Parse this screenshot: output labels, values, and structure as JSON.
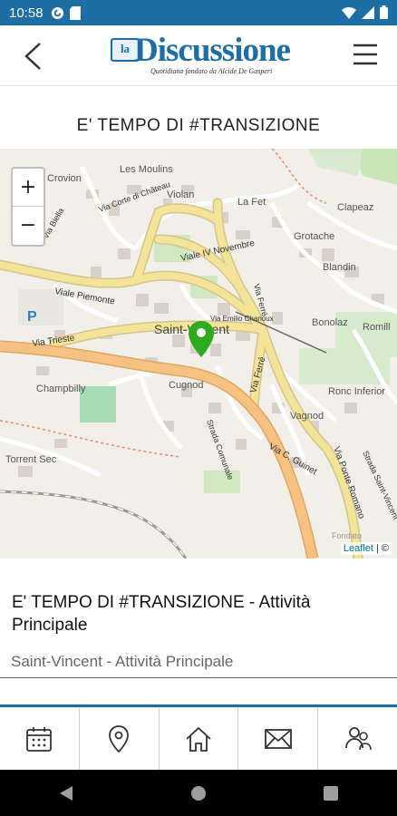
{
  "status_bar": {
    "time": "10:58",
    "left_icons": [
      "pocket-casts-icon",
      "sd-card-icon"
    ],
    "right_icons": [
      "wifi-icon",
      "signal-icon",
      "battery-icon"
    ]
  },
  "header": {
    "logo_prefix": "la",
    "logo_name": "Discussione",
    "logo_tagline": "Quotidiano fondato da Alcide De Gasperi",
    "back_icon": "chevron-left-icon",
    "menu_icon": "hamburger-menu-icon"
  },
  "page_title": "E' TEMPO DI #TRANSIZIONE",
  "map": {
    "zoom_in": "+",
    "zoom_out": "−",
    "attribution_link": "Leaflet",
    "attribution_rest": " | ©",
    "labels": {
      "crovion": "Crovion",
      "les_moulins": "Les Moulins",
      "violan": "Violan",
      "la_fet": "La Fet",
      "clapeaz": "Clapeaz",
      "grotache": "Grotache",
      "blandin": "Blandin",
      "bonolaz": "Bonolaz",
      "romill": "Romill",
      "viale_iv_novembre": "Viale IV Novembre",
      "viale_piemonte": "Viale Piemonte",
      "via_trieste": "Via Trieste",
      "via_emilio_chanoux": "Via Emilio Chanoux",
      "saint_vincent": "Saint-Vincent",
      "cugnod": "Cugnod",
      "champbilly": "Champbilly",
      "vagnod": "Vagnod",
      "ronc_inferior": "Ronc Inferior",
      "torrent_sec": "Torrent Sec",
      "via_ferre": "Via Ferré",
      "via_c_guinet": "Via C. Guinet",
      "via_ponte_romano": "Via Ponte Romano",
      "strada_saint_vincent": "Strada Saint-Vincent",
      "strada_comunale": "Strada Comunale",
      "via_corte_di_chateau": "Via Corte di Château",
      "via_biella": "Via Biella",
      "via_ferre_2": "Via Ferré",
      "fondato": "Fondato",
      "parking": "P"
    }
  },
  "event": {
    "title": "E' TEMPO DI #TRANSIZIONE - Attività Principale",
    "location": "Saint-Vincent - Attività Principale"
  },
  "tabs": [
    {
      "icon": "calendar-icon"
    },
    {
      "icon": "map-pin-icon"
    },
    {
      "icon": "home-icon"
    },
    {
      "icon": "mail-icon"
    },
    {
      "icon": "users-icon"
    }
  ],
  "nav": {
    "back": "nav-back-icon",
    "home": "nav-home-icon",
    "recents": "nav-recents-icon"
  },
  "colors": {
    "brand": "#1c6ea4",
    "marker": "#2daa1e",
    "main_road": "#f3e49a",
    "major_road": "#f5c281",
    "park": "#c8e6b8"
  }
}
